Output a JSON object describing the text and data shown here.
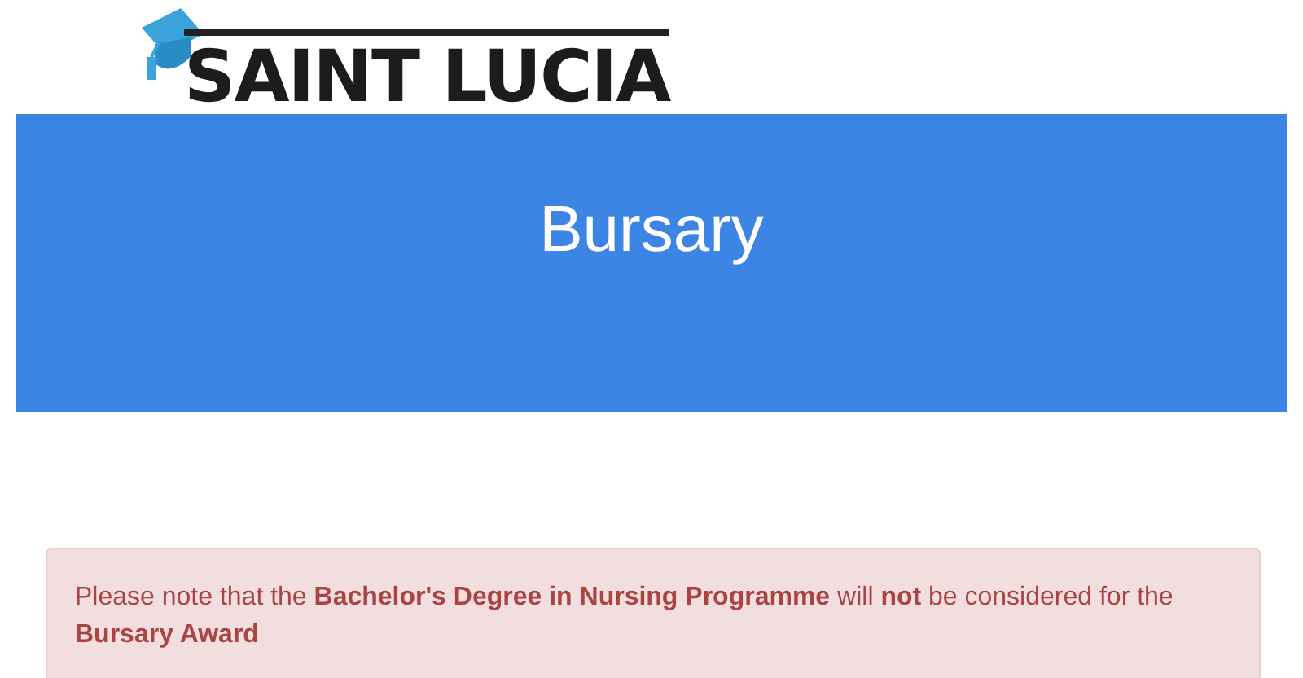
{
  "logo": {
    "text": "SAINT LUCIA"
  },
  "banner": {
    "title": "Bursary"
  },
  "alert": {
    "message": "Please note that the **Bachelor's Degree in Nursing Programme** will **not** be considered for the **Bursary Award**"
  }
}
